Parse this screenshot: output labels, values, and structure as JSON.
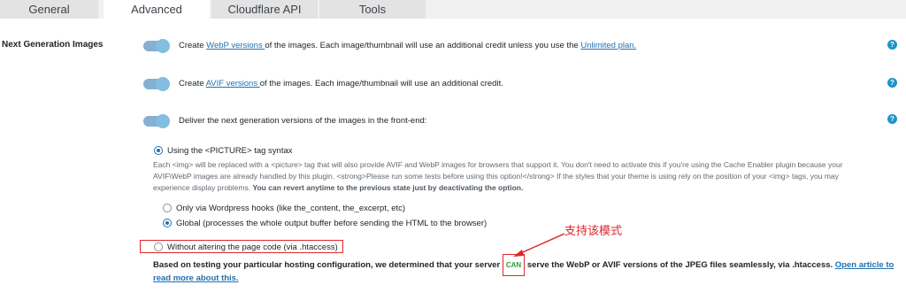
{
  "tabs": [
    {
      "label": "General"
    },
    {
      "label": "Advanced"
    },
    {
      "label": "Cloudflare API"
    },
    {
      "label": "Tools"
    }
  ],
  "section_label": "Next Generation Images",
  "options": {
    "webp": {
      "pre": "Create ",
      "link": "WebP versions ",
      "mid": "of the images. Each image/thumbnail will use an additional credit unless you use the ",
      "link2": "Unlimited plan."
    },
    "avif": {
      "pre": "Create ",
      "link": "AVIF versions ",
      "post": "of the images. Each image/thumbnail will use an additional credit."
    },
    "deliver": {
      "text": "Deliver the next generation versions of the images in the front-end:"
    }
  },
  "help_glyph": "?",
  "radios": {
    "picture": "Using the <PICTURE> tag syntax",
    "hooks": "Only via Wordpress hooks (like the_content, the_excerpt, etc)",
    "global": "Global (processes the whole output buffer before sending the HTML to the browser)",
    "htaccess": "Without altering the page code (via .htaccess)"
  },
  "picture_desc": {
    "text": "Each <img> will be replaced with a <picture> tag that will also provide AVIF and WebP images for browsers that support it. You don't need to activate this if you're using the Cache Enabler plugin because your AVIF\\WebP images are already handled by this plugin. <strong>Please run some tests before using this option!</strong> If the styles that your theme is using rely on the position of your <img> tags, you may experience display problems. ",
    "bold": "You can revert anytime to the previous state just by deactivating the option."
  },
  "result": {
    "pre": "Based on testing your particular hosting configuration, we determined that your server ",
    "badge": "CAN",
    "post": " serve the WebP or AVIF versions of the JPEG files seamlessly, via .htaccess. ",
    "link": "Open article to read more about this."
  },
  "annotation": "支持该模式",
  "colors": {
    "accent": "#2271b1",
    "annotation_red": "#e0262a",
    "can_green": "#2e9e37"
  }
}
